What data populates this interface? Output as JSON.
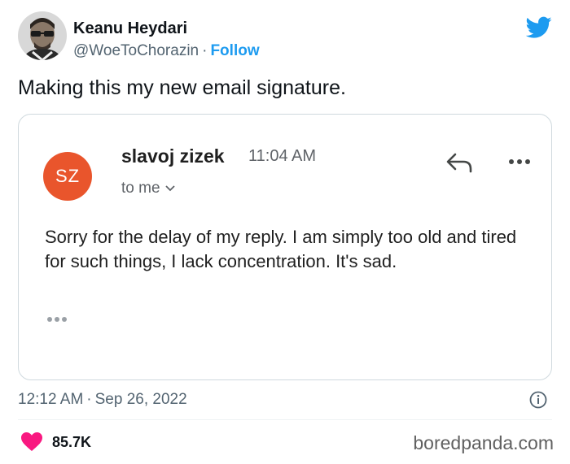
{
  "tweet": {
    "author_name": "Keanu Heydari",
    "author_handle": "@WoeToChorazin",
    "separator": "·",
    "follow_label": "Follow",
    "text": "Making this my new email signature.",
    "time": "12:12 AM",
    "date": "Sep 26, 2022",
    "like_count": "85.7K",
    "icons": {
      "logo": "twitter-bird-icon",
      "info": "info-icon",
      "like": "heart-icon"
    },
    "colors": {
      "link": "#1d9bf0",
      "heart": "#f91880",
      "muted": "#536471"
    }
  },
  "email": {
    "sender_initials": "SZ",
    "sender_name": "slavoj zizek",
    "time": "11:04 AM",
    "recipient": "to me",
    "body": "Sorry for the delay of my reply. I am simply too old and tired for such things, I lack concentration. It's sad.",
    "icons": {
      "reply": "reply-arrow-icon",
      "more": "more-dots-icon",
      "expand": "trimmed-content-dots-icon"
    },
    "colors": {
      "avatar_bg": "#e9552c"
    }
  },
  "watermark": "boredpanda.com"
}
